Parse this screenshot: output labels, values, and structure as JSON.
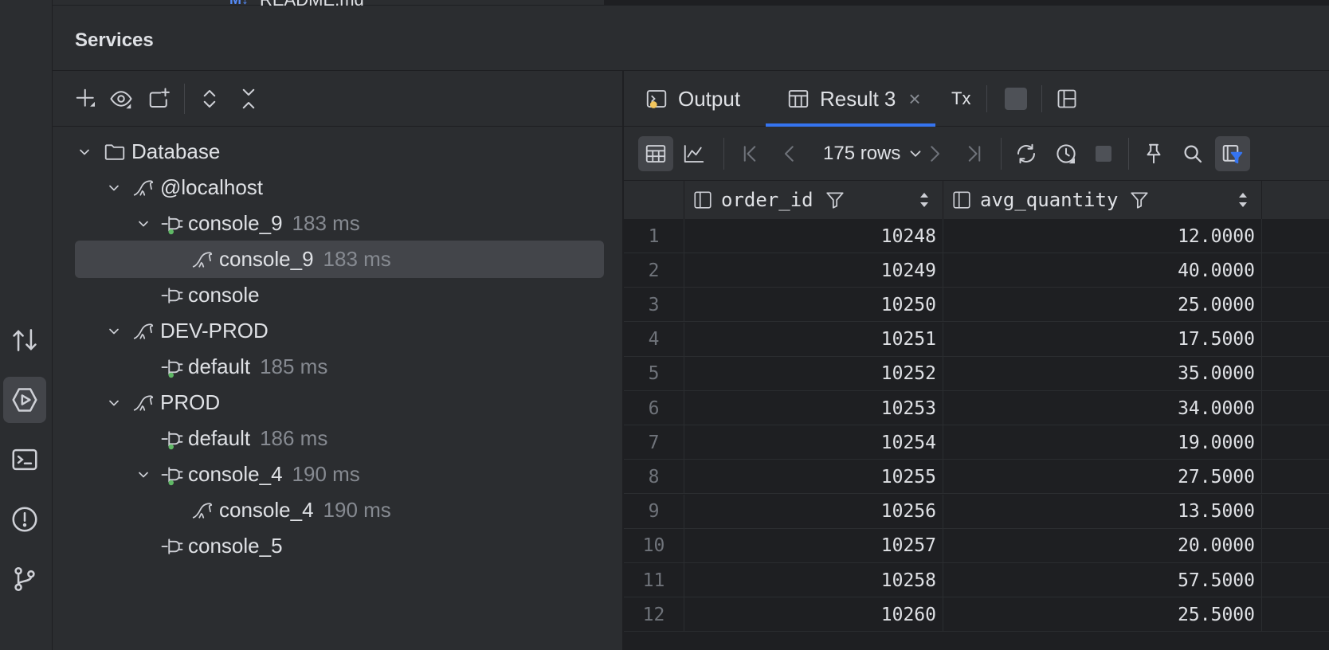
{
  "top": {
    "file_label": "README.md",
    "file_badge": "M↓"
  },
  "services": {
    "title": "Services"
  },
  "tree": [
    {
      "label": "Database",
      "timing": ""
    },
    {
      "label": "@localhost",
      "timing": ""
    },
    {
      "label": "console_9",
      "timing": "183 ms"
    },
    {
      "label": "console_9",
      "timing": "183 ms"
    },
    {
      "label": "console",
      "timing": ""
    },
    {
      "label": "DEV-PROD",
      "timing": ""
    },
    {
      "label": "default",
      "timing": "185 ms"
    },
    {
      "label": "PROD",
      "timing": ""
    },
    {
      "label": "default",
      "timing": "186 ms"
    },
    {
      "label": "console_4",
      "timing": "190 ms"
    },
    {
      "label": "console_4",
      "timing": "190 ms"
    },
    {
      "label": "console_5",
      "timing": ""
    }
  ],
  "tabs": {
    "output": "Output",
    "result": "Result 3",
    "close": "×",
    "tx": "Tx"
  },
  "grid": {
    "rows_label": "175 rows"
  },
  "table": {
    "columns": [
      "order_id",
      "avg_quantity"
    ],
    "rows": [
      {
        "n": "1",
        "order_id": "10248",
        "avg": "12.0000"
      },
      {
        "n": "2",
        "order_id": "10249",
        "avg": "40.0000"
      },
      {
        "n": "3",
        "order_id": "10250",
        "avg": "25.0000"
      },
      {
        "n": "4",
        "order_id": "10251",
        "avg": "17.5000"
      },
      {
        "n": "5",
        "order_id": "10252",
        "avg": "35.0000"
      },
      {
        "n": "6",
        "order_id": "10253",
        "avg": "34.0000"
      },
      {
        "n": "7",
        "order_id": "10254",
        "avg": "19.0000"
      },
      {
        "n": "8",
        "order_id": "10255",
        "avg": "27.5000"
      },
      {
        "n": "9",
        "order_id": "10256",
        "avg": "13.5000"
      },
      {
        "n": "10",
        "order_id": "10257",
        "avg": "20.0000"
      },
      {
        "n": "11",
        "order_id": "10258",
        "avg": "57.5000"
      },
      {
        "n": "12",
        "order_id": "10260",
        "avg": "25.5000"
      }
    ]
  },
  "colors": {
    "accent": "#3574f0",
    "connected_dot": "#5fb865",
    "selected_row": "#43454a"
  }
}
